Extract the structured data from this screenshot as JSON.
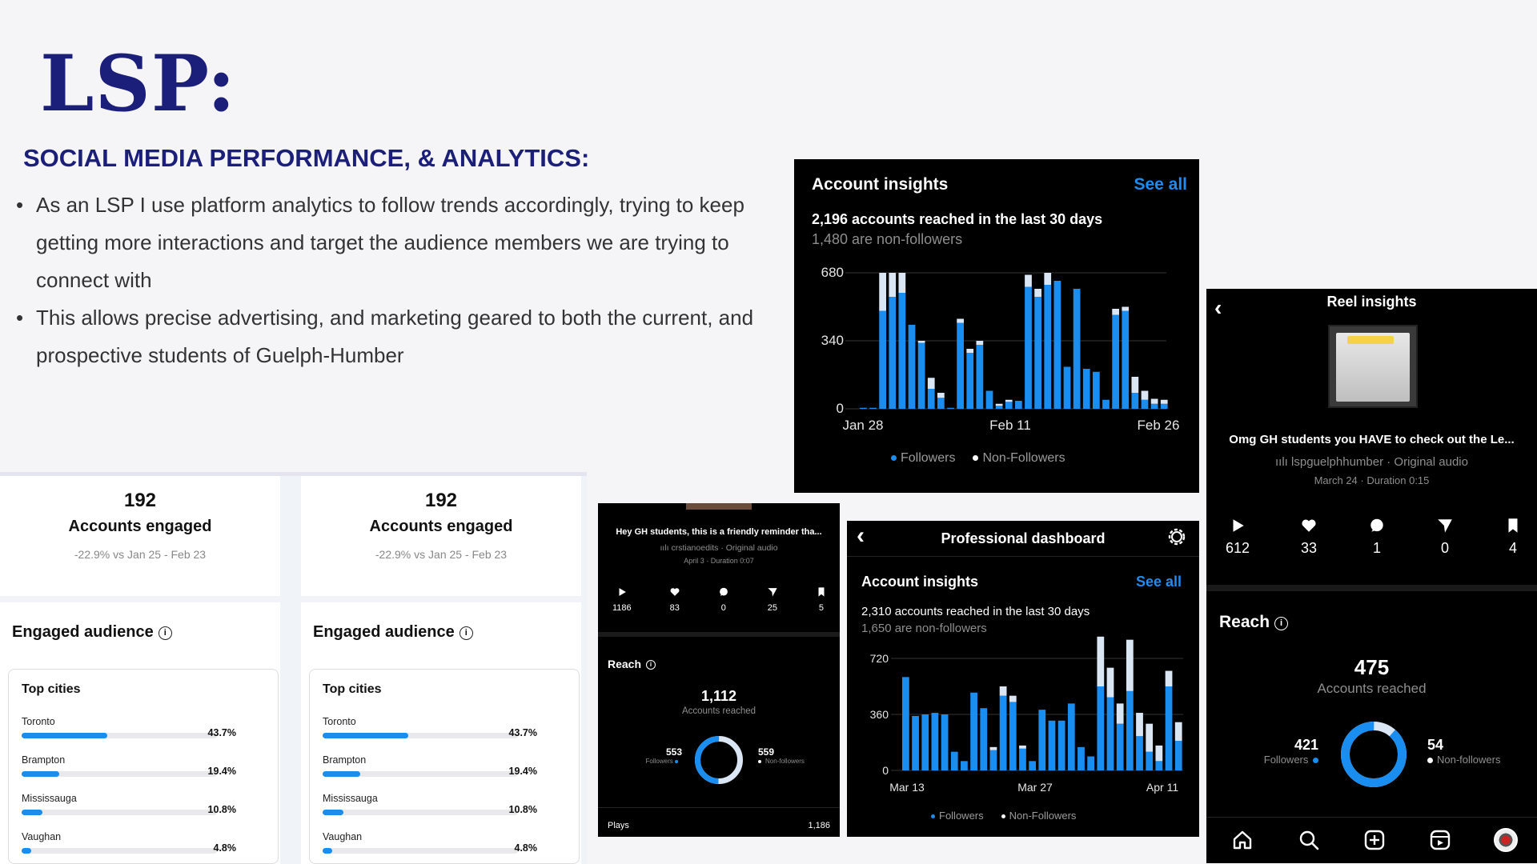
{
  "slide": {
    "title": "LSP:",
    "subtitle": "SOCIAL MEDIA PERFORMANCE, & ANALYTICS:",
    "bullets": [
      "As an LSP I use platform analytics to follow trends accordingly, trying to keep getting more interactions and target the audience members we are trying to connect with",
      "This allows precise advertising, and marketing geared to both the current, and prospective students of Guelph-Humber"
    ]
  },
  "insights_top": {
    "title": "Account insights",
    "see_all": "See all",
    "reached": "2,196 accounts reached in the last 30 days",
    "non_followers": "1,480 are non-followers",
    "legend": [
      "Followers",
      "Non-Followers"
    ]
  },
  "insights_bottom": {
    "header": "Professional dashboard",
    "title": "Account insights",
    "see_all": "See all",
    "reached": "2,310 accounts reached in the last 30 days",
    "non_followers": "1,650 are non-followers",
    "legend": [
      "Followers",
      "Non-Followers"
    ]
  },
  "reel_big": {
    "header": "Reel insights",
    "caption": "Omg GH students you HAVE to check out the Le...",
    "audio": "lspguelphhumber · Original audio",
    "meta": "March 24 · Duration 0:15",
    "stats": [
      "612",
      "33",
      "1",
      "0",
      "4"
    ],
    "reach_title": "Reach",
    "reach_value": "475",
    "reach_label": "Accounts reached",
    "followers_value": "421",
    "followers_label": "Followers",
    "nonfollowers_value": "54",
    "nonfollowers_label": "Non-followers",
    "follower_share": 0.886
  },
  "reel_small": {
    "caption": "Hey GH students, this is a friendly reminder tha...",
    "audio": "crstianoedits · Original audio",
    "meta": "April 3 · Duration 0:07",
    "stats": [
      "1186",
      "83",
      "0",
      "25",
      "5"
    ],
    "reach_title": "Reach",
    "reach_value": "1,112",
    "reach_label": "Accounts reached",
    "followers_value": "553",
    "followers_label": "Followers",
    "nonfollowers_value": "559",
    "nonfollowers_label": "Non-followers",
    "plays_label": "Plays",
    "plays_value": "1,186",
    "follower_share": 0.497
  },
  "audience_cards": [
    {
      "value": "192",
      "label": "Accounts engaged",
      "comparison": "-22.9% vs Jan 25 - Feb 23",
      "engaged_title": "Engaged audience",
      "cities_title": "Top cities",
      "cities": [
        {
          "name": "Toronto",
          "pct": "43.7%",
          "share": 0.437
        },
        {
          "name": "Brampton",
          "pct": "19.4%",
          "share": 0.194
        },
        {
          "name": "Mississauga",
          "pct": "10.8%",
          "share": 0.108
        },
        {
          "name": "Vaughan",
          "pct": "4.8%",
          "share": 0.048
        }
      ]
    },
    {
      "value": "192",
      "label": "Accounts engaged",
      "comparison": "-22.9% vs Jan 25 - Feb 23",
      "engaged_title": "Engaged audience",
      "cities_title": "Top cities",
      "cities": [
        {
          "name": "Toronto",
          "pct": "43.7%",
          "share": 0.437
        },
        {
          "name": "Brampton",
          "pct": "19.4%",
          "share": 0.194
        },
        {
          "name": "Mississauga",
          "pct": "10.8%",
          "share": 0.108
        },
        {
          "name": "Vaughan",
          "pct": "4.8%",
          "share": 0.048
        }
      ]
    }
  ],
  "colors": {
    "title_navy": "#1c1f7a",
    "followers_blue": "#1a8ef0",
    "non_followers_light": "#dbe6f5",
    "see_all_blue": "#1e8cf0"
  },
  "chart_data": [
    {
      "type": "bar",
      "stacked": true,
      "x_tick_labels": [
        "Jan 28",
        "Feb 11",
        "Feb 26"
      ],
      "ylim": [
        0,
        680
      ],
      "y_ticks": [
        "680",
        "340",
        "0"
      ],
      "grid": true,
      "legend": "bottom",
      "series": [
        {
          "name": "Followers",
          "values": [
            5,
            5,
            490,
            560,
            580,
            420,
            330,
            100,
            55,
            5,
            430,
            280,
            320,
            90,
            15,
            35,
            40,
            610,
            560,
            620,
            640,
            210,
            600,
            200,
            185,
            45,
            470,
            490,
            80,
            45,
            25,
            25
          ]
        },
        {
          "name": "Non-Followers",
          "values": [
            0,
            0,
            190,
            120,
            100,
            0,
            10,
            55,
            25,
            0,
            20,
            20,
            20,
            0,
            10,
            10,
            0,
            60,
            40,
            60,
            0,
            0,
            0,
            0,
            0,
            0,
            30,
            20,
            80,
            45,
            25,
            20
          ]
        }
      ]
    },
    {
      "type": "bar",
      "stacked": true,
      "x_tick_labels": [
        "Mar 13",
        "Mar 27",
        "Apr 11"
      ],
      "ylim": [
        0,
        720
      ],
      "y_ticks": [
        "720",
        "360",
        "0"
      ],
      "grid": true,
      "legend": "bottom",
      "series": [
        {
          "name": "Followers",
          "values": [
            600,
            350,
            360,
            370,
            360,
            120,
            60,
            500,
            400,
            130,
            480,
            440,
            140,
            60,
            390,
            320,
            320,
            430,
            150,
            90,
            540,
            470,
            300,
            510,
            220,
            120,
            60,
            540,
            190
          ]
        },
        {
          "name": "Non-Followers",
          "values": [
            0,
            0,
            0,
            0,
            0,
            0,
            0,
            0,
            0,
            20,
            60,
            40,
            20,
            0,
            0,
            0,
            0,
            0,
            0,
            0,
            320,
            190,
            130,
            330,
            150,
            180,
            100,
            100,
            120
          ]
        }
      ]
    },
    {
      "type": "pie",
      "labels": [
        "Followers",
        "Non-followers"
      ],
      "values": [
        421,
        54
      ]
    },
    {
      "type": "pie",
      "labels": [
        "Followers",
        "Non-followers"
      ],
      "values": [
        553,
        559
      ]
    }
  ]
}
